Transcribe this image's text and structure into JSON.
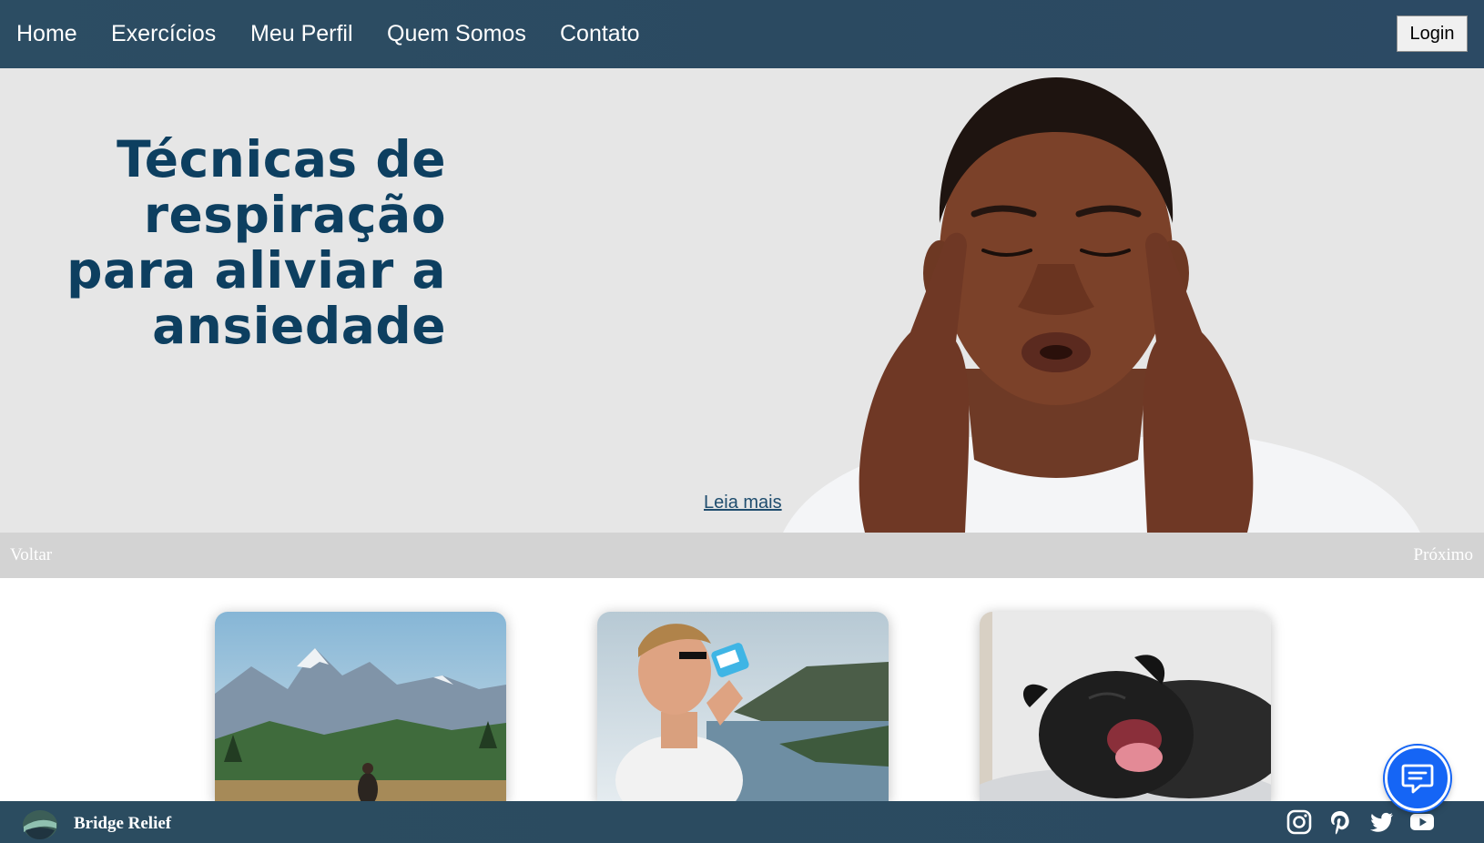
{
  "nav": {
    "links": [
      "Home",
      "Exercícios",
      "Meu Perfil",
      "Quem Somos",
      "Contato"
    ],
    "login_label": "Login"
  },
  "hero": {
    "title_lines": [
      "Técnicas de",
      "respiração",
      "para aliviar a",
      "ansiedade"
    ],
    "read_more": "Leia mais"
  },
  "carousel": {
    "prev_label": "Voltar",
    "next_label": "Próximo"
  },
  "cards": [
    {
      "image": "mountain-landscape"
    },
    {
      "image": "man-drinking-water"
    },
    {
      "image": "yawning-pug"
    }
  ],
  "footer": {
    "brand_name": "Bridge Relief",
    "social_icons": [
      "instagram-icon",
      "pinterest-icon",
      "twitter-icon",
      "youtube-icon"
    ]
  },
  "chat": {
    "icon": "chat-icon"
  },
  "colors": {
    "navbar": "#2b4a61",
    "hero_title": "#0d3f60",
    "hero_background": "#e6e6e6",
    "carousel_bar": "#d3d3d3",
    "chat_button": "#1565f5"
  }
}
